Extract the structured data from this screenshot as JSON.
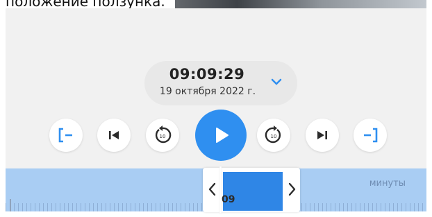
{
  "top": {
    "caption": "положение ползунка."
  },
  "header": {
    "time": "09:09:29",
    "date": "19 октября 2022 г."
  },
  "controls": [
    {
      "id": "mark-in",
      "icon": "bracket-left-minus-icon"
    },
    {
      "id": "skip-to-start",
      "icon": "skip-previous-icon"
    },
    {
      "id": "rewind-10",
      "icon": "rewind-10-icon",
      "label": "10"
    },
    {
      "id": "play",
      "icon": "play-icon"
    },
    {
      "id": "forward-10",
      "icon": "forward-10-icon",
      "label": "10"
    },
    {
      "id": "skip-to-end",
      "icon": "skip-next-icon"
    },
    {
      "id": "mark-out",
      "icon": "bracket-right-minus-icon"
    }
  ],
  "timeline": {
    "unit_label": "минуты",
    "cursor_label": "09"
  },
  "colors": {
    "accent": "#2f8ff0",
    "timeline_bg": "#a9cdf3",
    "selection": "#2f86e6",
    "panel_bg": "#f1f1f1"
  }
}
